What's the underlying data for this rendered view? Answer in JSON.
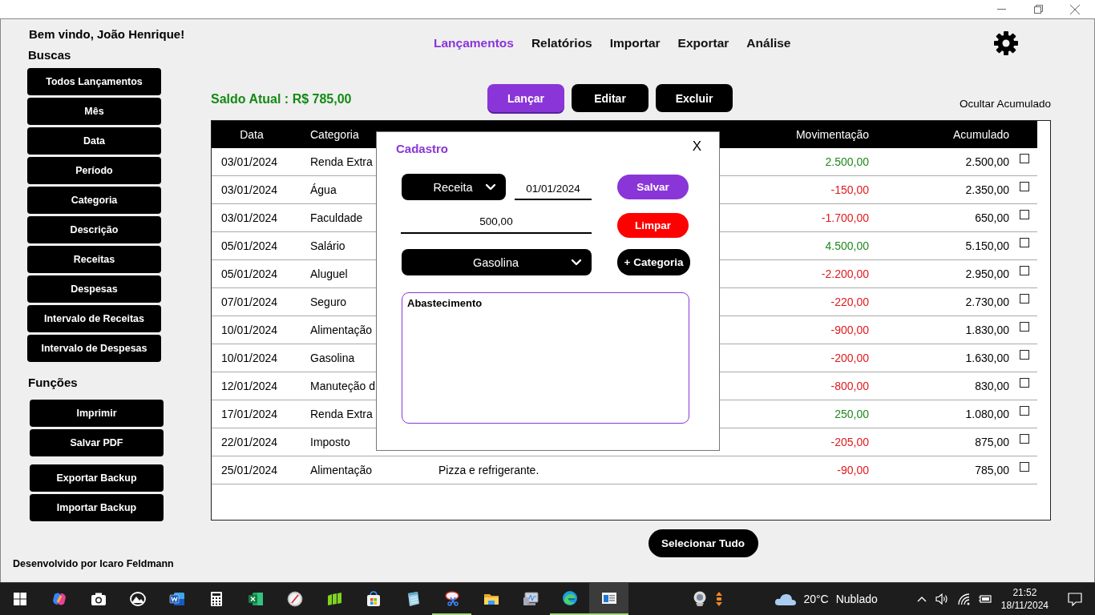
{
  "sidebar": {
    "greeting": "Bem vindo, João Henrique!",
    "search_title": "Buscas",
    "search_buttons": [
      "Todos Lançamentos",
      "Mês",
      "Data",
      "Período",
      "Categoria",
      "Descrição",
      "Receitas",
      "Despesas",
      "Intervalo de Receitas",
      "Intervalo de Despesas"
    ],
    "functions_title": "Funções",
    "function_groups": [
      [
        "Imprimir",
        "Salvar PDF"
      ],
      [
        "Exportar Backup",
        "Importar Backup"
      ]
    ],
    "footer": "Desenvolvido por Icaro Feldmann"
  },
  "nav": {
    "tabs": [
      {
        "label": "Lançamentos",
        "selected": true
      },
      {
        "label": "Relatórios",
        "selected": false
      },
      {
        "label": "Importar",
        "selected": false
      },
      {
        "label": "Exportar",
        "selected": false
      },
      {
        "label": "Análise",
        "selected": false
      }
    ]
  },
  "balance": "Saldo Atual : R$ 785,00",
  "actions": [
    {
      "label": "Lançar",
      "kind": "primary"
    },
    {
      "label": "Editar",
      "kind": "default"
    },
    {
      "label": "Excluir",
      "kind": "default"
    }
  ],
  "hide_cumulative": "Ocultar Acumulado",
  "table": {
    "columns": [
      "Data",
      "Categoria",
      "Movimentação",
      "Acumulado"
    ],
    "rows": [
      {
        "date": "03/01/2024",
        "category": "Renda Extra",
        "amount": "2.500,00",
        "color": "#1e8a1e",
        "balance": "2.500,00",
        "checked": false
      },
      {
        "date": "03/01/2024",
        "category": "Água",
        "amount": "-150,00",
        "color": "#e0191c",
        "balance": "2.350,00",
        "checked": false
      },
      {
        "date": "03/01/2024",
        "category": "Faculdade",
        "amount": "-1.700,00",
        "color": "#e0191c",
        "balance": "650,00",
        "checked": false
      },
      {
        "date": "05/01/2024",
        "category": "Salário",
        "amount": "4.500,00",
        "color": "#1e8a1e",
        "balance": "5.150,00",
        "checked": false
      },
      {
        "date": "05/01/2024",
        "category": "Aluguel",
        "amount": "-2.200,00",
        "color": "#e0191c",
        "balance": "2.950,00",
        "checked": false
      },
      {
        "date": "07/01/2024",
        "category": "Seguro",
        "amount": "-220,00",
        "color": "#e0191c",
        "balance": "2.730,00",
        "checked": false
      },
      {
        "date": "10/01/2024",
        "category": "Alimentação",
        "amount": "-900,00",
        "color": "#e0191c",
        "balance": "1.830,00",
        "checked": false
      },
      {
        "date": "10/01/2024",
        "category": "Gasolina",
        "amount": "-200,00",
        "color": "#e0191c",
        "balance": "1.630,00",
        "checked": false
      },
      {
        "date": "12/01/2024",
        "category": "Manuteção d",
        "amount": "-800,00",
        "color": "#e0191c",
        "balance": "830,00",
        "checked": false
      },
      {
        "date": "17/01/2024",
        "category": "Renda Extra",
        "amount": "250,00",
        "color": "#1e8a1e",
        "balance": "1.080,00",
        "checked": false
      },
      {
        "date": "22/01/2024",
        "category": "Imposto",
        "amount": "-205,00",
        "color": "#e0191c",
        "balance": "875,00",
        "checked": false
      },
      {
        "date": "25/01/2024",
        "category": "Alimentação",
        "description": "Pizza e refrigerante.",
        "amount": "-90,00",
        "color": "#e0191c",
        "balance": "785,00",
        "checked": false
      }
    ]
  },
  "select_all": "Selecionar Tudo",
  "modal": {
    "title": "Cadastro",
    "close": "X",
    "type_select": "Receita",
    "date": "01/01/2024",
    "amount": "500,00",
    "category_select": "Gasolina",
    "description": "Abastecimento",
    "buttons": [
      {
        "label": "Salvar",
        "kind": "save"
      },
      {
        "label": "Limpar",
        "kind": "clear"
      },
      {
        "label": "+ Categoria",
        "kind": "add"
      }
    ]
  },
  "taskbar": {
    "apps": [
      {
        "kind": "start",
        "running": false,
        "active": false
      },
      {
        "kind": "ribbon",
        "running": false,
        "active": false
      },
      {
        "kind": "camera",
        "running": false,
        "active": false
      },
      {
        "kind": "mountain",
        "running": false,
        "active": false
      },
      {
        "kind": "word",
        "running": false,
        "active": false
      },
      {
        "kind": "calculator",
        "running": false,
        "active": false
      },
      {
        "kind": "sheet",
        "running": false,
        "active": false
      },
      {
        "kind": "compass",
        "running": false,
        "active": false
      },
      {
        "kind": "bars",
        "running": false,
        "active": false
      },
      {
        "kind": "store",
        "running": false,
        "active": false
      },
      {
        "kind": "notepad",
        "running": false,
        "active": false
      },
      {
        "kind": "scissors",
        "running": true,
        "active": false
      },
      {
        "kind": "folder",
        "running": false,
        "active": false
      },
      {
        "kind": "monitor",
        "running": false,
        "active": false
      },
      {
        "kind": "swirl",
        "running": true,
        "active": false
      },
      {
        "kind": "window",
        "running": true,
        "active": true
      }
    ],
    "temperature": "20°C",
    "weather": "Nublado",
    "time": "21:52",
    "date": "18/11/2024"
  }
}
